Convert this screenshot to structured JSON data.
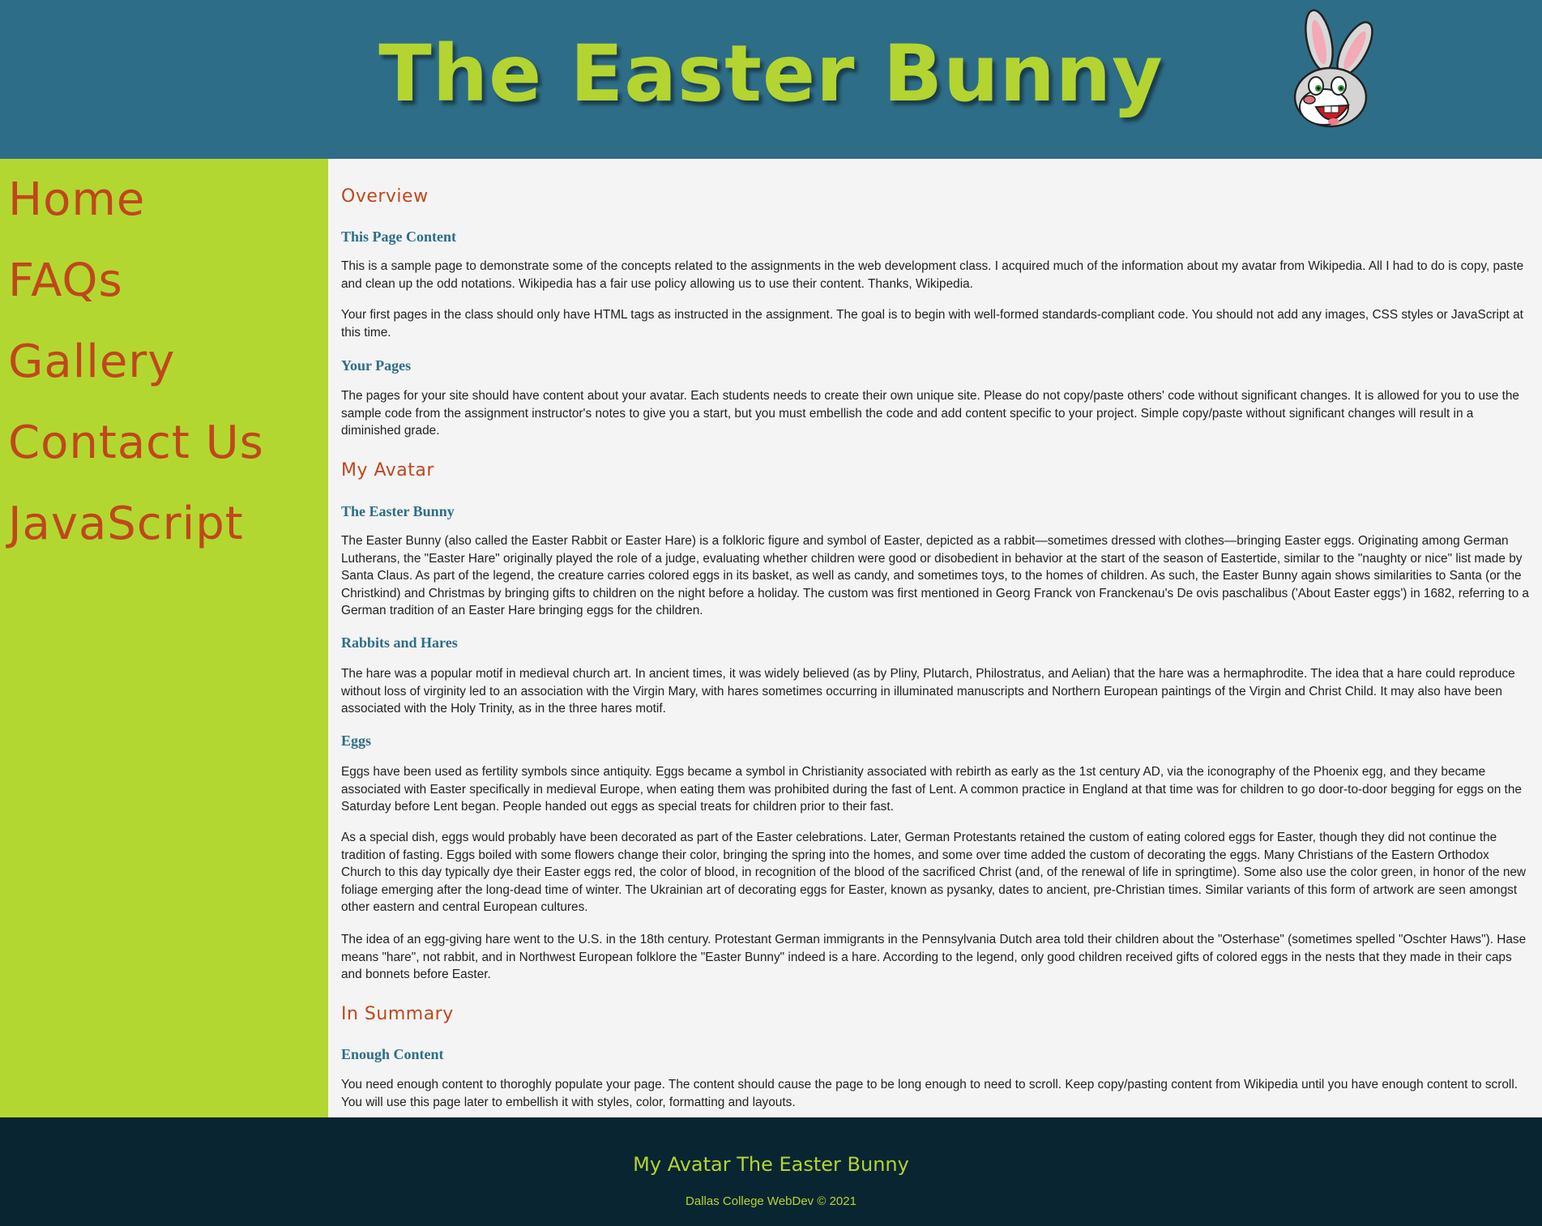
{
  "header": {
    "title": "The Easter Bunny",
    "logo_icon": "bunny-head-icon"
  },
  "nav": {
    "items": [
      {
        "label": "Home"
      },
      {
        "label": "FAQs"
      },
      {
        "label": "Gallery"
      },
      {
        "label": "Contact Us"
      },
      {
        "label": "JavaScript"
      }
    ]
  },
  "main": {
    "overview_heading": "Overview",
    "this_page_content_heading": "This Page Content",
    "this_page_content_p1": "This is a sample page to demonstrate some of the concepts related to the assignments in the web development class. I acquired much of the information about my avatar from Wikipedia. All I had to do is copy, paste and clean up the odd notations. Wikipedia has a fair use policy allowing us to use their content. Thanks, Wikipedia.",
    "this_page_content_p2": "Your first pages in the class should only have HTML tags as instructed in the assignment. The goal is to begin with well-formed standards-compliant code. You should not add any images, CSS styles or JavaScript at this time.",
    "your_pages_heading": "Your Pages",
    "your_pages_p1": "The pages for your site should have content about your avatar. Each students needs to create their own unique site. Please do not copy/paste others' code without significant changes. It is allowed for you to use the sample code from the assignment instructor's notes to give you a start, but you must embellish the code and add content specific to your project. Simple copy/paste without significant changes will result in a diminished grade.",
    "my_avatar_heading": "My Avatar",
    "easter_bunny_heading": "The Easter Bunny",
    "easter_bunny_p1": "The Easter Bunny (also called the Easter Rabbit or Easter Hare) is a folkloric figure and symbol of Easter, depicted as a rabbit—sometimes dressed with clothes—bringing Easter eggs. Originating among German Lutherans, the \"Easter Hare\" originally played the role of a judge, evaluating whether children were good or disobedient in behavior at the start of the season of Eastertide, similar to the \"naughty or nice\" list made by Santa Claus. As part of the legend, the creature carries colored eggs in its basket, as well as candy, and sometimes toys, to the homes of children. As such, the Easter Bunny again shows similarities to Santa (or the Christkind) and Christmas by bringing gifts to children on the night before a holiday. The custom was first mentioned in Georg Franck von Franckenau's De ovis paschalibus ('About Easter eggs') in 1682, referring to a German tradition of an Easter Hare bringing eggs for the children.",
    "rabbits_heading": "Rabbits and Hares",
    "rabbits_p1": "The hare was a popular motif in medieval church art. In ancient times, it was widely believed (as by Pliny, Plutarch, Philostratus, and Aelian) that the hare was a hermaphrodite. The idea that a hare could reproduce without loss of virginity led to an association with the Virgin Mary, with hares sometimes occurring in illuminated manuscripts and Northern European paintings of the Virgin and Christ Child. It may also have been associated with the Holy Trinity, as in the three hares motif.",
    "eggs_heading": "Eggs",
    "eggs_p1": "Eggs have been used as fertility symbols since antiquity. Eggs became a symbol in Christianity associated with rebirth as early as the 1st century AD, via the iconography of the Phoenix egg, and they became associated with Easter specifically in medieval Europe, when eating them was prohibited during the fast of Lent. A common practice in England at that time was for children to go door-to-door begging for eggs on the Saturday before Lent began. People handed out eggs as special treats for children prior to their fast.",
    "eggs_p2": "As a special dish, eggs would probably have been decorated as part of the Easter celebrations. Later, German Protestants retained the custom of eating colored eggs for Easter, though they did not continue the tradition of fasting. Eggs boiled with some flowers change their color, bringing the spring into the homes, and some over time added the custom of decorating the eggs. Many Christians of the Eastern Orthodox Church to this day typically dye their Easter eggs red, the color of blood, in recognition of the blood of the sacrificed Christ (and, of the renewal of life in springtime). Some also use the color green, in honor of the new foliage emerging after the long-dead time of winter. The Ukrainian art of decorating eggs for Easter, known as pysanky, dates to ancient, pre-Christian times. Similar variants of this form of artwork are seen amongst other eastern and central European cultures.",
    "eggs_p3": "The idea of an egg-giving hare went to the U.S. in the 18th century. Protestant German immigrants in the Pennsylvania Dutch area told their children about the \"Osterhase\" (sometimes spelled \"Oschter Haws\"). Hase means \"hare\", not rabbit, and in Northwest European folklore the \"Easter Bunny\" indeed is a hare. According to the legend, only good children received gifts of colored eggs in the nests that they made in their caps and bonnets before Easter.",
    "summary_heading": "In Summary",
    "enough_heading": "Enough Content",
    "enough_p1": "You need enough content to thoroghly populate your page. The content should cause the page to be long enough to need to scroll. Keep copy/pasting content from Wikipedia until you have enough content to scroll. You will use this page later to embellish it with styles, color, formatting and layouts."
  },
  "footer": {
    "title": "My Avatar The Easter Bunny",
    "copyright": "Dallas College WebDev © 2021"
  },
  "colors": {
    "header_bg": "#2e6d88",
    "accent_green": "#b3d431",
    "accent_orange": "#c0471c",
    "footer_bg": "#0a2532",
    "content_bg": "#f4f4f4"
  }
}
